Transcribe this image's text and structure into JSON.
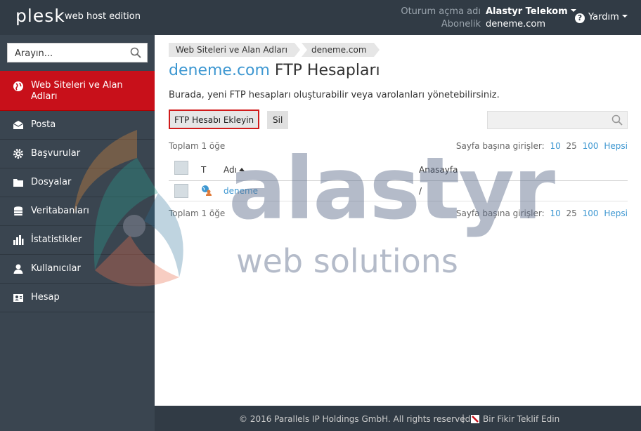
{
  "header": {
    "logo": "plesk",
    "edition": "web host edition",
    "login_label": "Oturum açma adı",
    "login_user": "Alastyr Telekom",
    "subscription_label": "Abonelik",
    "subscription_value": "deneme.com",
    "help_label": "Yardım"
  },
  "sidebar": {
    "search_placeholder": "Arayın...",
    "items": [
      {
        "label": "Web Siteleri ve Alan Adları",
        "icon": "globe-icon"
      },
      {
        "label": "Posta",
        "icon": "mail-icon"
      },
      {
        "label": "Başvurular",
        "icon": "gear-icon"
      },
      {
        "label": "Dosyalar",
        "icon": "folder-icon"
      },
      {
        "label": "Veritabanları",
        "icon": "database-icon"
      },
      {
        "label": "İstatistikler",
        "icon": "bar-chart-icon"
      },
      {
        "label": "Kullanıcılar",
        "icon": "user-icon"
      },
      {
        "label": "Hesap",
        "icon": "account-icon"
      }
    ]
  },
  "main": {
    "breadcrumb": [
      "Web Siteleri ve Alan Adları",
      "deneme.com"
    ],
    "title_domain": "deneme.com",
    "title_rest": " FTP Hesapları",
    "description": "Burada, yeni FTP hesapları oluşturabilir veya varolanları yönetebilirsiniz.",
    "add_button": "FTP Hesabı Ekleyin",
    "delete_button": "Sil",
    "total": "Toplam 1 öğe",
    "per_page_label": "Sayfa başına girişler:",
    "per_page_options": [
      "10",
      "25",
      "100",
      "Hepsi"
    ],
    "table": {
      "columns": [
        "T",
        "Adı",
        "Anasayfa"
      ],
      "rows": [
        {
          "name": "deneme",
          "home": "/"
        }
      ]
    }
  },
  "footer": {
    "copyright": "© 2016 Parallels IP Holdings GmbH. All rights reserved.",
    "separator": "|",
    "feedback": "Bir Fikir Teklif Edin"
  },
  "watermark": {
    "line1": "alastyr",
    "line2": "web solutions"
  },
  "colors": {
    "header_bg": "#313b45",
    "sidebar_bg": "#3a4550",
    "active_nav": "#c8101a",
    "link": "#3d97d1"
  }
}
